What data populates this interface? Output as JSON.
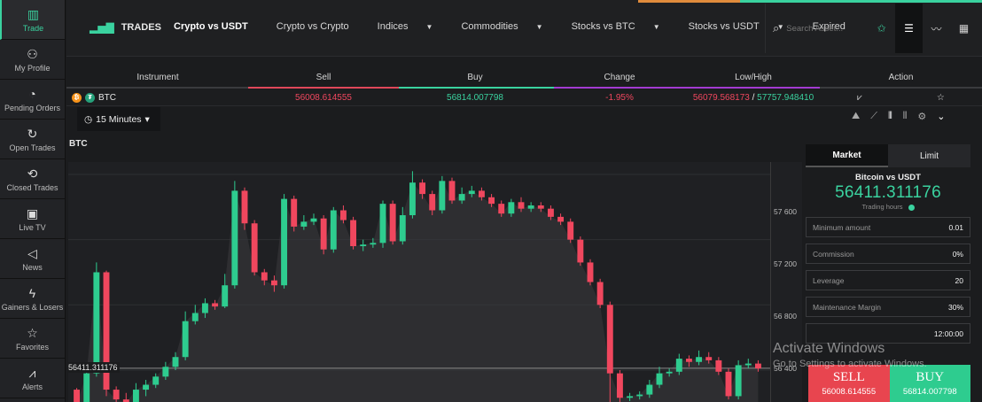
{
  "sidebar": {
    "items": [
      {
        "label": "Trade",
        "icon": "chart-bars-icon",
        "glyph": "▥"
      },
      {
        "label": "My Profile",
        "icon": "user-icon",
        "glyph": "⚇"
      },
      {
        "label": "Pending Orders",
        "icon": "timer-icon",
        "glyph": "◔"
      },
      {
        "label": "Open Trades",
        "icon": "refresh-icon",
        "glyph": "↻"
      },
      {
        "label": "Closed Trades",
        "icon": "closed-trades-icon",
        "glyph": "⟲"
      },
      {
        "label": "Live TV",
        "icon": "tv-icon",
        "glyph": "▣"
      },
      {
        "label": "News",
        "icon": "megaphone-icon",
        "glyph": "◁"
      },
      {
        "label": "Gainers & Losers",
        "icon": "lightning-icon",
        "glyph": "ϟ"
      },
      {
        "label": "Favorites",
        "icon": "star-icon",
        "glyph": "☆"
      },
      {
        "label": "Alerts",
        "icon": "alert-icon",
        "glyph": "⩘"
      }
    ]
  },
  "topnav": {
    "logo": "TRADES",
    "menu": [
      {
        "label": "Crypto vs USDT",
        "dropdown": false
      },
      {
        "label": "Crypto vs Crypto",
        "dropdown": false
      },
      {
        "label": "Indices",
        "dropdown": true
      },
      {
        "label": "Commodities",
        "dropdown": true
      },
      {
        "label": "Stocks vs BTC",
        "dropdown": true
      },
      {
        "label": "Stocks vs USDT",
        "dropdown": true
      },
      {
        "label": "Expired",
        "dropdown": false
      }
    ],
    "search_placeholder": "Search Asset..."
  },
  "table": {
    "headers": [
      "Instrument",
      "Sell",
      "Buy",
      "Change",
      "Low/High",
      "Action"
    ],
    "row": {
      "instrument": "BTC",
      "sell": "56008.614555",
      "buy": "56814.007798",
      "change": "-1.95%",
      "low": "56079.568173",
      "high": "57757.948410",
      "separator": "/"
    }
  },
  "chart": {
    "timeframe": "15 Minutes",
    "symbol": "BTC",
    "current_price": "56411.311176",
    "price_labels": [
      "57 600",
      "57 200",
      "56 800",
      "56 400"
    ]
  },
  "chart_data": {
    "type": "candlestick",
    "symbol": "BTC",
    "ylim": [
      56150,
      57600
    ],
    "candles": [
      {
        "o": 56280,
        "c": 56190,
        "h": 56290,
        "l": 56160
      },
      {
        "o": 56190,
        "c": 56380,
        "h": 56420,
        "l": 56180
      },
      {
        "o": 56380,
        "c": 57000,
        "h": 57060,
        "l": 56360
      },
      {
        "o": 57000,
        "c": 56280,
        "h": 57010,
        "l": 56240
      },
      {
        "o": 56280,
        "c": 56220,
        "h": 56300,
        "l": 56200
      },
      {
        "o": 56220,
        "c": 56200,
        "h": 56260,
        "l": 56180
      },
      {
        "o": 56200,
        "c": 56280,
        "h": 56320,
        "l": 56180
      },
      {
        "o": 56280,
        "c": 56310,
        "h": 56340,
        "l": 56240
      },
      {
        "o": 56310,
        "c": 56360,
        "h": 56380,
        "l": 56290
      },
      {
        "o": 56360,
        "c": 56420,
        "h": 56450,
        "l": 56340
      },
      {
        "o": 56420,
        "c": 56480,
        "h": 56510,
        "l": 56400
      },
      {
        "o": 56480,
        "c": 56700,
        "h": 56760,
        "l": 56460
      },
      {
        "o": 56700,
        "c": 56750,
        "h": 56800,
        "l": 56680
      },
      {
        "o": 56750,
        "c": 56810,
        "h": 56840,
        "l": 56720
      },
      {
        "o": 56810,
        "c": 56790,
        "h": 56830,
        "l": 56770
      },
      {
        "o": 56790,
        "c": 56920,
        "h": 56990,
        "l": 56780
      },
      {
        "o": 56920,
        "c": 57500,
        "h": 57560,
        "l": 56900
      },
      {
        "o": 57500,
        "c": 57300,
        "h": 57520,
        "l": 57260
      },
      {
        "o": 57300,
        "c": 57000,
        "h": 57320,
        "l": 56980
      },
      {
        "o": 57000,
        "c": 56950,
        "h": 57020,
        "l": 56920
      },
      {
        "o": 56950,
        "c": 56920,
        "h": 56980,
        "l": 56880
      },
      {
        "o": 56920,
        "c": 57450,
        "h": 57480,
        "l": 56900
      },
      {
        "o": 57450,
        "c": 57280,
        "h": 57470,
        "l": 57250
      },
      {
        "o": 57280,
        "c": 57310,
        "h": 57350,
        "l": 57260
      },
      {
        "o": 57310,
        "c": 57330,
        "h": 57360,
        "l": 57290
      },
      {
        "o": 57330,
        "c": 57140,
        "h": 57350,
        "l": 57110
      },
      {
        "o": 57140,
        "c": 57380,
        "h": 57400,
        "l": 57120
      },
      {
        "o": 57380,
        "c": 57320,
        "h": 57410,
        "l": 57300
      },
      {
        "o": 57320,
        "c": 57160,
        "h": 57340,
        "l": 57140
      },
      {
        "o": 57160,
        "c": 57170,
        "h": 57200,
        "l": 57130
      },
      {
        "o": 57170,
        "c": 57180,
        "h": 57210,
        "l": 57150
      },
      {
        "o": 57180,
        "c": 57420,
        "h": 57440,
        "l": 57150
      },
      {
        "o": 57420,
        "c": 57190,
        "h": 57440,
        "l": 57170
      },
      {
        "o": 57190,
        "c": 57350,
        "h": 57400,
        "l": 57170
      },
      {
        "o": 57350,
        "c": 57550,
        "h": 57620,
        "l": 57330
      },
      {
        "o": 57550,
        "c": 57480,
        "h": 57570,
        "l": 57450
      },
      {
        "o": 57480,
        "c": 57380,
        "h": 57500,
        "l": 57350
      },
      {
        "o": 57380,
        "c": 57560,
        "h": 57590,
        "l": 57360
      },
      {
        "o": 57560,
        "c": 57440,
        "h": 57580,
        "l": 57420
      },
      {
        "o": 57440,
        "c": 57480,
        "h": 57520,
        "l": 57420
      },
      {
        "o": 57480,
        "c": 57500,
        "h": 57530,
        "l": 57460
      },
      {
        "o": 57500,
        "c": 57460,
        "h": 57520,
        "l": 57440
      },
      {
        "o": 57460,
        "c": 57420,
        "h": 57480,
        "l": 57400
      },
      {
        "o": 57420,
        "c": 57360,
        "h": 57440,
        "l": 57340
      },
      {
        "o": 57360,
        "c": 57430,
        "h": 57450,
        "l": 57340
      },
      {
        "o": 57430,
        "c": 57390,
        "h": 57460,
        "l": 57370
      },
      {
        "o": 57390,
        "c": 57410,
        "h": 57430,
        "l": 57370
      },
      {
        "o": 57410,
        "c": 57390,
        "h": 57430,
        "l": 57370
      },
      {
        "o": 57390,
        "c": 57340,
        "h": 57410,
        "l": 57320
      },
      {
        "o": 57340,
        "c": 57310,
        "h": 57360,
        "l": 57290
      },
      {
        "o": 57310,
        "c": 57200,
        "h": 57330,
        "l": 57180
      },
      {
        "o": 57200,
        "c": 57060,
        "h": 57220,
        "l": 57040
      },
      {
        "o": 57060,
        "c": 56940,
        "h": 57080,
        "l": 56920
      },
      {
        "o": 56940,
        "c": 56800,
        "h": 56960,
        "l": 56780
      },
      {
        "o": 56800,
        "c": 56380,
        "h": 56820,
        "l": 56170
      },
      {
        "o": 56380,
        "c": 56230,
        "h": 56400,
        "l": 56200
      },
      {
        "o": 56230,
        "c": 56240,
        "h": 56260,
        "l": 56210
      },
      {
        "o": 56240,
        "c": 56250,
        "h": 56270,
        "l": 56220
      },
      {
        "o": 56250,
        "c": 56310,
        "h": 56340,
        "l": 56230
      },
      {
        "o": 56310,
        "c": 56380,
        "h": 56420,
        "l": 56290
      },
      {
        "o": 56380,
        "c": 56390,
        "h": 56410,
        "l": 56360
      },
      {
        "o": 56390,
        "c": 56470,
        "h": 56500,
        "l": 56370
      },
      {
        "o": 56470,
        "c": 56450,
        "h": 56490,
        "l": 56420
      },
      {
        "o": 56450,
        "c": 56480,
        "h": 56520,
        "l": 56430
      },
      {
        "o": 56480,
        "c": 56460,
        "h": 56510,
        "l": 56440
      },
      {
        "o": 56460,
        "c": 56390,
        "h": 56480,
        "l": 56370
      },
      {
        "o": 56390,
        "c": 56240,
        "h": 56410,
        "l": 56220
      },
      {
        "o": 56240,
        "c": 56430,
        "h": 56460,
        "l": 56220
      },
      {
        "o": 56430,
        "c": 56440,
        "h": 56470,
        "l": 56410
      },
      {
        "o": 56440,
        "c": 56410,
        "h": 56460,
        "l": 56390
      }
    ]
  },
  "order": {
    "tabs": [
      "Market",
      "Limit"
    ],
    "pair": "Bitcoin vs USDT",
    "price": "56411.311176",
    "trading_hours": "Trading hours",
    "fields": [
      {
        "label": "Minimum amount",
        "value": "0.01"
      },
      {
        "label": "Commission",
        "value": "0%"
      },
      {
        "label": "Leverage",
        "value": "20"
      },
      {
        "label": "Maintenance Margin",
        "value": "30%"
      },
      {
        "label": "",
        "value": "12:00:00"
      }
    ],
    "sell_label": "SELL",
    "sell_price": "56008.614555",
    "buy_label": "BUY",
    "buy_price": "56814.007798"
  },
  "watermark": {
    "title": "Activate Windows",
    "subtitle": "Go to Settings to activate Windows."
  },
  "colors": {
    "up": "#2ecc8f",
    "down": "#f0475e",
    "accent": "#3ad29f"
  }
}
